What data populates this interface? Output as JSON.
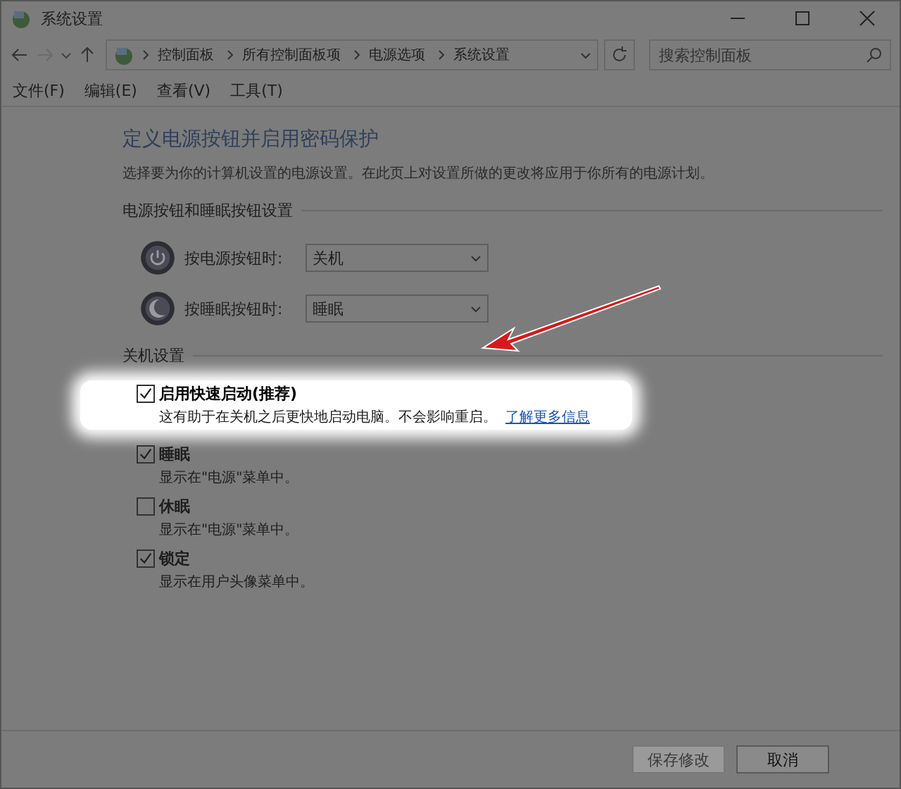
{
  "window": {
    "title": "系统设置"
  },
  "address_bar": {
    "breadcrumb": [
      "控制面板",
      "所有控制面板项",
      "电源选项",
      "系统设置"
    ]
  },
  "search": {
    "placeholder": "搜索控制面板"
  },
  "menu": [
    "文件(F)",
    "编辑(E)",
    "查看(V)",
    "工具(T)"
  ],
  "heading": "定义电源按钮并启用密码保护",
  "description": "选择要为你的计算机设置的电源设置。在此页上对设置所做的更改将应用于你所有的电源计划。",
  "button_section": {
    "title": "电源按钮和睡眠按钮设置",
    "rows": [
      {
        "kind": "power",
        "label": "按电源按钮时:",
        "value": "关机"
      },
      {
        "kind": "sleep",
        "label": "按睡眠按钮时:",
        "value": "睡眠"
      }
    ]
  },
  "shutdown_section": {
    "title": "关机设置",
    "options": [
      {
        "label": "启用快速启动(推荐)",
        "description": "这有助于在关机之后更快地启动电脑。不会影响重启。",
        "link": "了解更多信息",
        "checked": true,
        "highlighted": true
      },
      {
        "label": "睡眠",
        "description": "显示在\"电源\"菜单中。",
        "checked": true,
        "highlighted": false
      },
      {
        "label": "休眠",
        "description": "显示在\"电源\"菜单中。",
        "checked": false,
        "highlighted": false
      },
      {
        "label": "锁定",
        "description": "显示在用户头像菜单中。",
        "checked": true,
        "highlighted": false
      }
    ]
  },
  "buttons": [
    {
      "label": "保存修改",
      "disabled": true
    },
    {
      "label": "取消",
      "disabled": false
    }
  ]
}
